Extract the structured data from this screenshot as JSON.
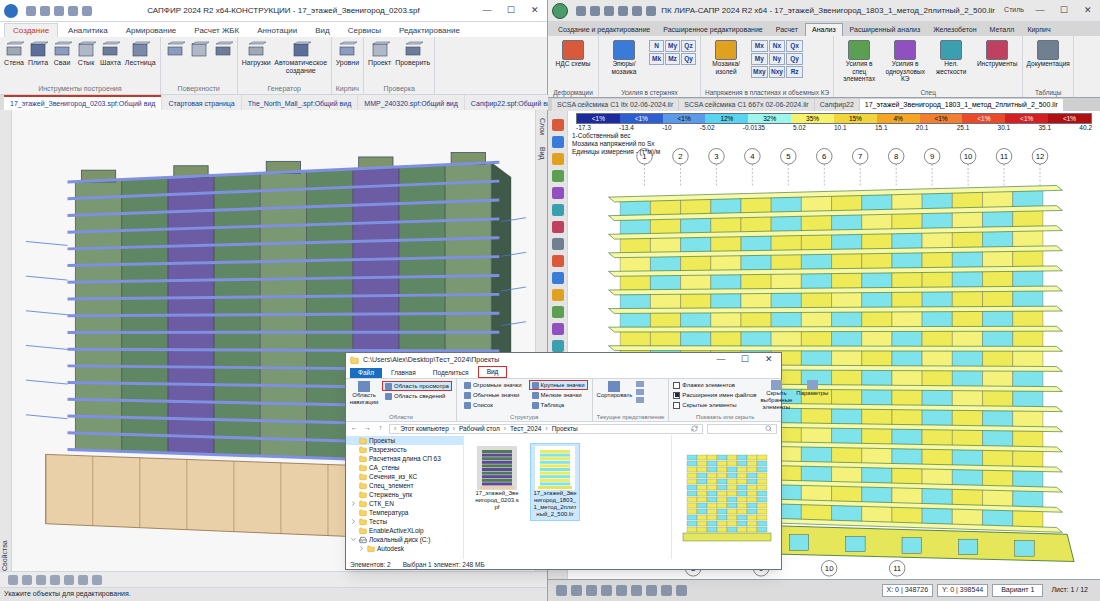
{
  "sapfir": {
    "title": "САПФИР 2024 R2 x64-КОНСТРУКЦИИ - 17_этажей_Звенигород_0203.spf",
    "controls": [
      "—",
      "☐",
      "✕"
    ],
    "tabs": [
      {
        "label": "Создание",
        "selected": true
      },
      {
        "label": "Аналитика",
        "selected": false
      },
      {
        "label": "Армирование",
        "selected": false
      },
      {
        "label": "Расчет ЖБК",
        "selected": false
      },
      {
        "label": "Аннотации",
        "selected": false
      },
      {
        "label": "Вид",
        "selected": false
      },
      {
        "label": "Сервисы",
        "selected": false
      },
      {
        "label": "Редактирование",
        "selected": false
      }
    ],
    "ribbon_groups": [
      {
        "label": "Инструменты построения",
        "tools": [
          "Стена",
          "Плита",
          "Сваи",
          "Стык",
          "Шахта",
          "Лестница"
        ]
      },
      {
        "label": "Поверхности",
        "tools": []
      },
      {
        "label": "Генератор",
        "tools": [
          "Нагрузки",
          "Автоматическое создание"
        ]
      },
      {
        "label": "Кирпич",
        "tools": [
          "Уровни"
        ]
      },
      {
        "label": "Проверка",
        "tools": [
          "Проект",
          "Проверить"
        ]
      }
    ],
    "doc_tabs": [
      {
        "label": "17_этажей_Звенигород_0203.spf:Общий вид",
        "selected": true
      },
      {
        "label": "Стартовая страница",
        "selected": false
      },
      {
        "label": "The_North_Mall_.spf:Общий вид",
        "selected": false
      },
      {
        "label": "ММР_240320.spf:Общий вид",
        "selected": false
      },
      {
        "label": "Сапфир22.spf:Общий вид",
        "selected": false
      }
    ],
    "side_left": "Свойства",
    "side_right": [
      "Слои",
      "Вид"
    ],
    "status": "Укажите объекты для редактирования."
  },
  "lira": {
    "title": "ПК ЛИРА-САПР 2024 R2 x64 - 17_этажей_Звенигород_1803_1_метод_2плитный_2_500.lir",
    "style_label": "Стиль",
    "controls": [
      "—",
      "☐",
      "✕"
    ],
    "tabs": [
      {
        "label": "Создание и редактирование",
        "selected": false
      },
      {
        "label": "Расширенное редактирование",
        "selected": false
      },
      {
        "label": "Расчет",
        "selected": false
      },
      {
        "label": "Анализ",
        "selected": true
      },
      {
        "label": "Расширенный анализ",
        "selected": false
      },
      {
        "label": "Железобетон",
        "selected": false
      },
      {
        "label": "Металл",
        "selected": false
      },
      {
        "label": "Кирпич",
        "selected": false
      }
    ],
    "ribbon_groups": [
      {
        "label": "Деформации",
        "buttons": [
          "НДС схемы"
        ],
        "glyphs": []
      },
      {
        "label": "Усилия в стержнях",
        "buttons": [
          "Эпюры/ мозаика"
        ],
        "glyphs": [
          "N",
          "My",
          "Qz",
          "Mk",
          "Mz",
          "Qy"
        ]
      },
      {
        "label": "Напряжения в пластинах и объемных КЭ",
        "buttons": [
          "Мозаика/ изолей"
        ],
        "glyphs": [
          "Mx",
          "Nx",
          "Qx",
          "My",
          "Ny",
          "Qy",
          "Mxy",
          "Nxy",
          "Rz"
        ]
      },
      {
        "label": "Спец",
        "buttons": [
          "Усилия в спец элементах",
          "Усилия в одноузловых КЭ",
          "Нел. жесткости",
          "Инструменты"
        ],
        "glyphs": []
      },
      {
        "label": "Таблицы",
        "buttons": [
          "Документация"
        ],
        "glyphs": []
      }
    ],
    "doc_tabs": [
      {
        "label": "SCSA сейсмика С1 ltx 02-06-2024.lir",
        "selected": false
      },
      {
        "label": "SCSA сейсмика С1 667x 02-06-2024.lir",
        "selected": false
      },
      {
        "label": "Сапфир22",
        "selected": false
      },
      {
        "label": "17_этажей_Звенигород_1803_1_метод_2плитный_2_500.lir",
        "selected": true
      }
    ],
    "scale": {
      "values": [
        "-17.3",
        "-13.4",
        "-10",
        "-5.02",
        "-0.0135",
        "5.02",
        "10.1",
        "15.1",
        "20.1",
        "25.1",
        "30.1",
        "35.1",
        "40.2"
      ],
      "cells": [
        {
          "pct": "<1%",
          "color": "#1c2a9c"
        },
        {
          "pct": "<1%",
          "color": "#2e5fd0"
        },
        {
          "pct": "<1%",
          "color": "#5b9ae8"
        },
        {
          "pct": "12%",
          "color": "#59d4f0"
        },
        {
          "pct": "32%",
          "color": "#9ef5ea"
        },
        {
          "pct": "35%",
          "color": "#f6f36a"
        },
        {
          "pct": "15%",
          "color": "#f2d53a"
        },
        {
          "pct": "4%",
          "color": "#f5a623"
        },
        {
          "pct": "<1%",
          "color": "#f08030"
        },
        {
          "pct": "<1%",
          "color": "#e84a2a"
        },
        {
          "pct": "<1%",
          "color": "#d42020"
        },
        {
          "pct": "<1%",
          "color": "#b01010"
        }
      ]
    },
    "info": [
      "1-Собственный вес",
      "Мозаика напряжений по Sx",
      "Единицы измерения - (т*м)/м"
    ],
    "axes": {
      "top": [
        "1",
        "2",
        "3",
        "4",
        "5",
        "6",
        "7",
        "8",
        "9",
        "10",
        "11",
        "12"
      ],
      "bottom": [
        "8",
        "9",
        "10",
        "11"
      ]
    },
    "status": {
      "coords": [
        "X: 0 | 348726",
        "Y: 0 | 398544"
      ],
      "variant": "Вариант 1",
      "sheet": "Лист: 1 / 12"
    }
  },
  "explorer": {
    "title": "C:\\Users\\Alex\\Desktop\\Тест_2024\\Проекты",
    "controls": [
      "—",
      "☐",
      "✕"
    ],
    "tabs": [
      {
        "label": "Файл",
        "selected": false
      },
      {
        "label": "Главная",
        "selected": false
      },
      {
        "label": "Поделиться",
        "selected": false
      },
      {
        "label": "Вид",
        "selected": true
      }
    ],
    "nav_pane": {
      "label": "Область навигации",
      "selected": false
    },
    "panes": [
      {
        "label": "Область просмотра",
        "selected": true
      },
      {
        "label": "Область сведений",
        "selected": false
      }
    ],
    "layouts": [
      {
        "label": "Огромные значки",
        "selected": false
      },
      {
        "label": "Крупные значки",
        "selected": true
      },
      {
        "label": "Обычные значки",
        "selected": false
      },
      {
        "label": "Мелкие значки",
        "selected": false
      },
      {
        "label": "Список",
        "selected": false
      },
      {
        "label": "Таблица",
        "selected": false
      }
    ],
    "sort": "Сортировать",
    "checks": [
      {
        "label": "Флажки элементов",
        "checked": false
      },
      {
        "label": "Расширения имен файлов",
        "checked": true
      },
      {
        "label": "Скрытые элементы",
        "checked": false
      }
    ],
    "hide": "Скрыть выбранные элементы",
    "params": "Параметры",
    "groups": [
      "Области",
      "Структура",
      "Текущее представление",
      "Показать или скрыть"
    ],
    "nav": [
      "←",
      "→",
      "↑"
    ],
    "address": [
      "Этот компьютер",
      "Рабочий стол",
      "Тест_2024",
      "Проекты"
    ],
    "address_sep": "›",
    "tree": [
      {
        "label": "Проекты",
        "selected": true,
        "kind": "folder",
        "expandable": false,
        "expanded": false,
        "children": []
      },
      {
        "label": "Разрезность",
        "selected": false,
        "kind": "folder",
        "expandable": false,
        "expanded": false,
        "children": []
      },
      {
        "label": "Расчетная длина СП 63",
        "selected": false,
        "kind": "folder",
        "expandable": false,
        "expanded": false,
        "children": []
      },
      {
        "label": "СА_стены",
        "selected": false,
        "kind": "folder",
        "expandable": false,
        "expanded": false,
        "children": []
      },
      {
        "label": "Сечения_из_КС",
        "selected": false,
        "kind": "folder",
        "expandable": false,
        "expanded": false,
        "children": []
      },
      {
        "label": "Спец_элемент",
        "selected": false,
        "kind": "folder",
        "expandable": false,
        "expanded": false,
        "children": []
      },
      {
        "label": "Стержень_упк",
        "selected": false,
        "kind": "folder",
        "expandable": false,
        "expanded": false,
        "children": []
      },
      {
        "label": "СТК_EN",
        "selected": false,
        "kind": "folder",
        "expandable": true,
        "expanded": false,
        "children": []
      },
      {
        "label": "Температура",
        "selected": false,
        "kind": "folder",
        "expandable": false,
        "expanded": false,
        "children": []
      },
      {
        "label": "Тесты",
        "selected": false,
        "kind": "folder",
        "expandable": true,
        "expanded": false,
        "children": []
      },
      {
        "label": "EnableActiveXLoip",
        "selected": false,
        "kind": "folder",
        "expandable": false,
        "expanded": false,
        "children": []
      },
      {
        "label": "Локальный диск (C:)",
        "selected": false,
        "kind": "drive",
        "expandable": true,
        "expanded": true,
        "children": [
          {
            "label": "Autodesk",
            "selected": false,
            "kind": "folder",
            "expandable": true,
            "expanded": false,
            "children": []
          }
        ]
      }
    ],
    "files": [
      {
        "name": "17_этажей_Звенигород_0203.spf",
        "selected": false,
        "kind": "spf"
      },
      {
        "name": "17_этажей_Звенигород_1803_1_метод_2плитный_2_500.lir",
        "selected": true,
        "kind": "lir"
      }
    ],
    "status": [
      "Элементов: 2",
      "Выбран 1 элемент: 248 МБ"
    ]
  }
}
